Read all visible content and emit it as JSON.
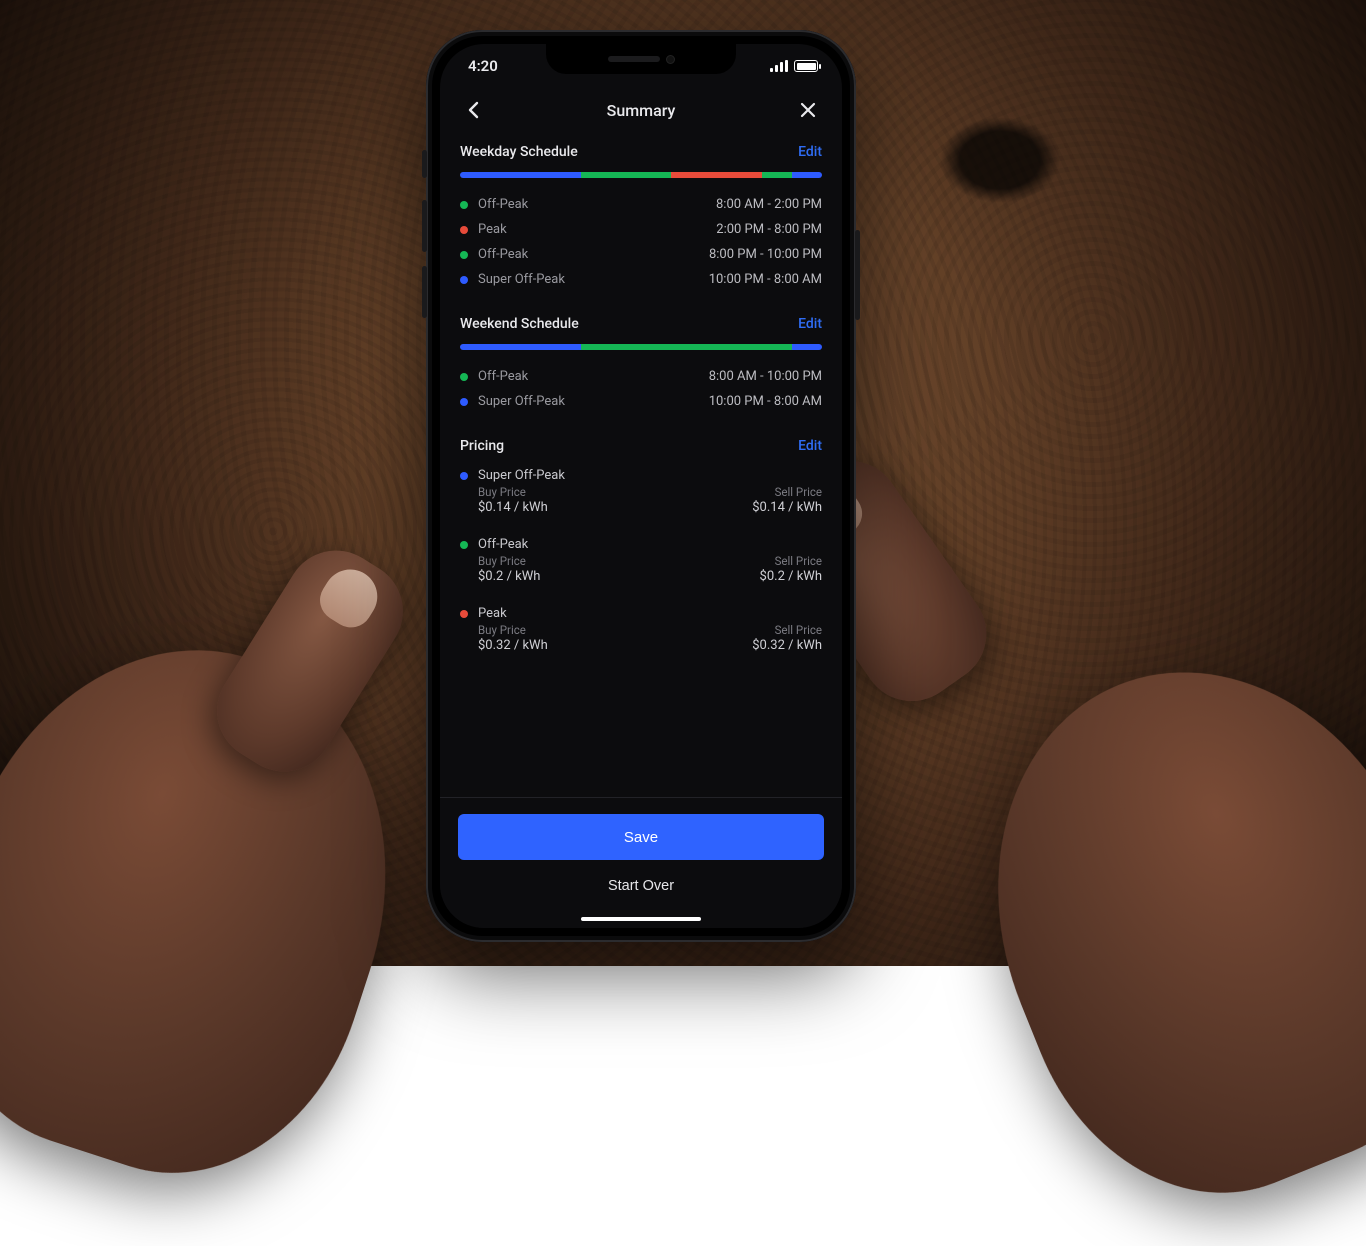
{
  "status": {
    "time": "4:20"
  },
  "nav": {
    "title": "Summary"
  },
  "colors": {
    "super_off_peak": "#2e5bff",
    "off_peak": "#15b755",
    "peak": "#e84b3a"
  },
  "weekday": {
    "title": "Weekday Schedule",
    "edit": "Edit",
    "segments": [
      {
        "color": "off_peak",
        "start_pct": 33.3,
        "end_pct": 58.3
      },
      {
        "color": "peak",
        "start_pct": 58.3,
        "end_pct": 83.3
      },
      {
        "color": "off_peak",
        "start_pct": 83.3,
        "end_pct": 91.7
      }
    ],
    "rows": [
      {
        "color": "off_peak",
        "label": "Off-Peak",
        "time": "8:00 AM - 2:00 PM"
      },
      {
        "color": "peak",
        "label": "Peak",
        "time": "2:00 PM - 8:00 PM"
      },
      {
        "color": "off_peak",
        "label": "Off-Peak",
        "time": "8:00 PM - 10:00 PM"
      },
      {
        "color": "super_off_peak",
        "label": "Super Off-Peak",
        "time": "10:00 PM - 8:00 AM"
      }
    ]
  },
  "weekend": {
    "title": "Weekend Schedule",
    "edit": "Edit",
    "segments": [
      {
        "color": "off_peak",
        "start_pct": 33.3,
        "end_pct": 91.7
      }
    ],
    "rows": [
      {
        "color": "off_peak",
        "label": "Off-Peak",
        "time": "8:00 AM - 10:00 PM"
      },
      {
        "color": "super_off_peak",
        "label": "Super Off-Peak",
        "time": "10:00 PM - 8:00 AM"
      }
    ]
  },
  "pricing": {
    "title": "Pricing",
    "edit": "Edit",
    "buy_label": "Buy Price",
    "sell_label": "Sell Price",
    "rows": [
      {
        "color": "super_off_peak",
        "label": "Super Off-Peak",
        "buy": "$0.14 / kWh",
        "sell": "$0.14 / kWh"
      },
      {
        "color": "off_peak",
        "label": "Off-Peak",
        "buy": "$0.2 / kWh",
        "sell": "$0.2 / kWh"
      },
      {
        "color": "peak",
        "label": "Peak",
        "buy": "$0.32 / kWh",
        "sell": "$0.32 / kWh"
      }
    ]
  },
  "buttons": {
    "save": "Save",
    "start_over": "Start Over"
  }
}
